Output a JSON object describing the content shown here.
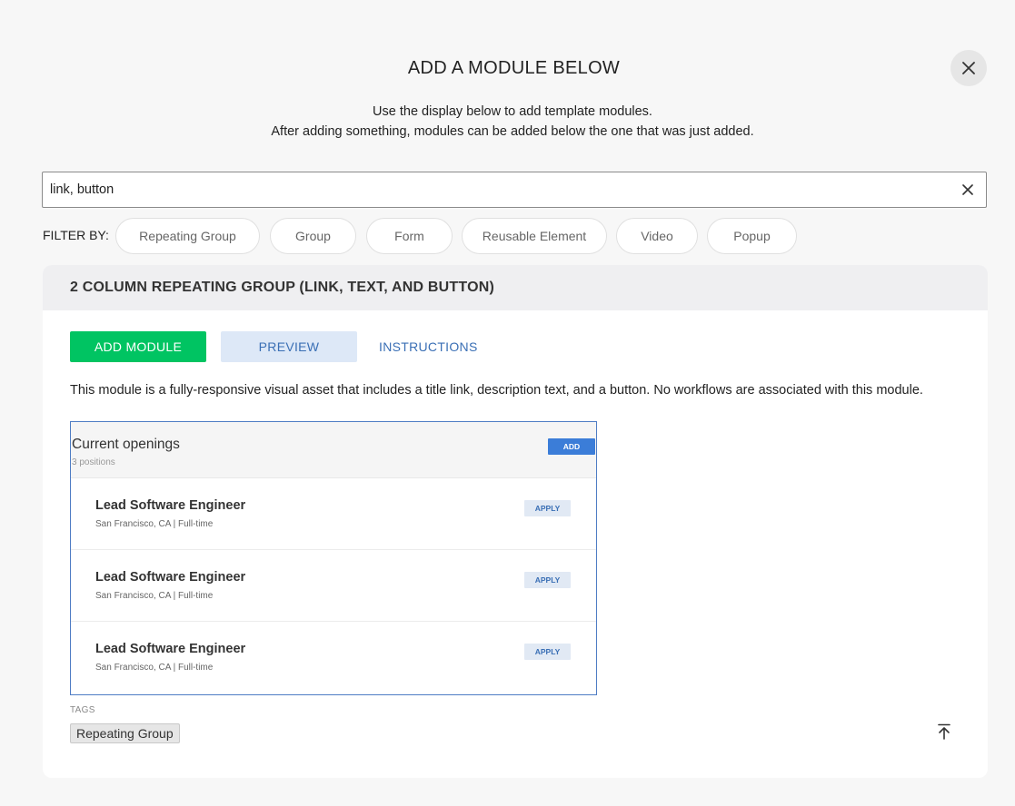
{
  "modal": {
    "title": "ADD A MODULE BELOW",
    "subtitle_line1": "Use the display below to add template modules.",
    "subtitle_line2": "After adding something, modules can be added below the one that was just added."
  },
  "search": {
    "value": "link, button"
  },
  "filters": {
    "label": "FILTER BY:",
    "chips": [
      "Repeating Group",
      "Group",
      "Form",
      "Reusable Element",
      "Video",
      "Popup"
    ]
  },
  "module": {
    "title": "2 COLUMN REPEATING GROUP (LINK, TEXT, AND BUTTON)",
    "add_label": "ADD MODULE",
    "preview_label": "PREVIEW",
    "instructions_label": "INSTRUCTIONS",
    "description": "This module is a fully-responsive visual asset that includes a title link, description text, and a button. No workflows are associated with this module.",
    "preview": {
      "heading": "Current openings",
      "count": "3 positions",
      "add_label": "ADD",
      "rows": [
        {
          "title": "Lead Software Engineer",
          "location": "San Francisco, CA  |  Full-time",
          "button": "APPLY"
        },
        {
          "title": "Lead Software Engineer",
          "location": "San Francisco, CA  |  Full-time",
          "button": "APPLY"
        },
        {
          "title": "Lead Software Engineer",
          "location": "San Francisco, CA  |  Full-time",
          "button": "APPLY"
        }
      ]
    },
    "tags_label": "TAGS",
    "tags": [
      "Repeating Group"
    ]
  },
  "colors": {
    "accent_green": "#00c462",
    "accent_blue": "#3a6fb5",
    "preview_border": "#4e7cc4"
  },
  "icons": {
    "close": "close-icon",
    "clear": "clear-icon",
    "scroll_top": "arrow-up-to-line-icon"
  }
}
